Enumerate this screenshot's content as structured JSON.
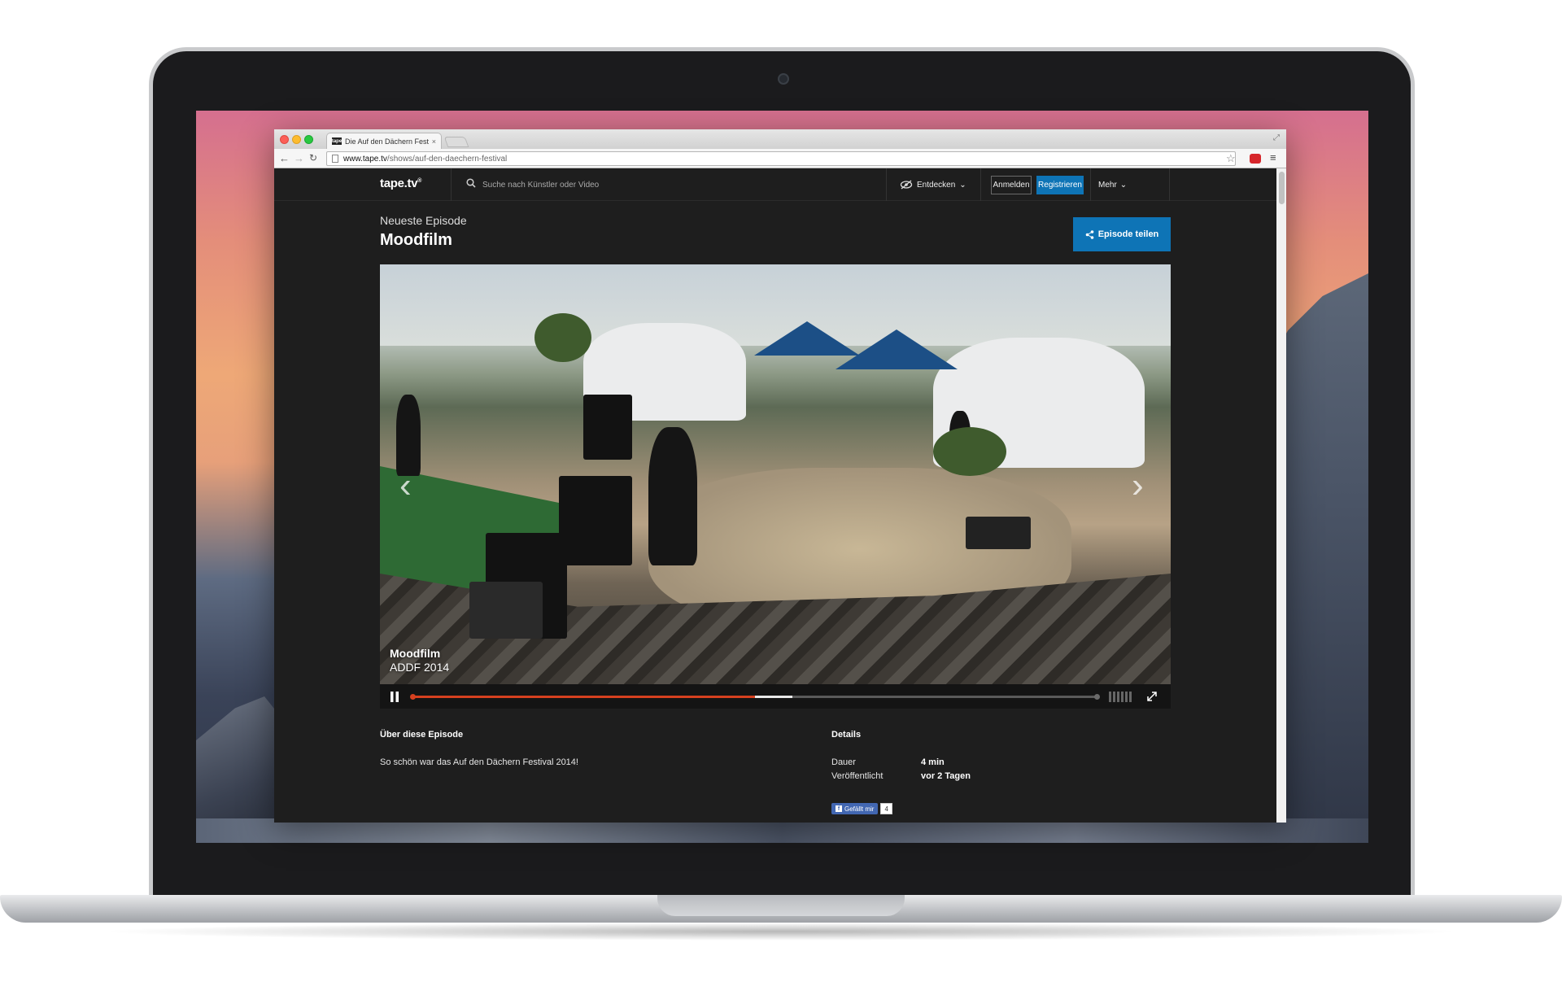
{
  "browser": {
    "tab_title": "Die Auf den Dächern Festi",
    "tab_close": "×",
    "favicon_text": "tape",
    "url_host": "www.tape.tv",
    "url_path": "/shows/auf-den-daechern-festival"
  },
  "site": {
    "logo": "tape.tv",
    "logo_mark": "®",
    "search_placeholder": "Suche nach Künstler oder Video",
    "nav": {
      "discover_label": "Entdecken",
      "login_label": "Anmelden",
      "register_label": "Registrieren",
      "more_label": "Mehr"
    }
  },
  "episode": {
    "eyebrow": "Neueste Episode",
    "title": "Moodfilm",
    "share_label": "Episode teilen"
  },
  "player": {
    "caption_title": "Moodfilm",
    "caption_subtitle": "ADDF 2014",
    "prev_arrow": "‹",
    "next_arrow": "›",
    "progress_played": 0.5,
    "progress_buffered": 0.555
  },
  "about": {
    "title": "Über diese Episode",
    "text": "So schön war das Auf den Dächern Festival 2014!"
  },
  "details": {
    "title": "Details",
    "rows": [
      {
        "label": "Dauer",
        "value": "4 min"
      },
      {
        "label": "Veröffentlicht",
        "value": "vor 2 Tagen"
      }
    ]
  },
  "facebook": {
    "like_label": "Gefällt mir",
    "count": "4"
  },
  "colors": {
    "accent_blue": "#0e74b6",
    "progress_red": "#d6401f",
    "page_bg": "#1e1e1e"
  },
  "icons": [
    "search-icon",
    "eye-slash-icon",
    "chevron-down-icon",
    "share-icon",
    "pause-icon",
    "volume-icon",
    "fullscreen-icon",
    "star-icon",
    "menu-icon"
  ]
}
